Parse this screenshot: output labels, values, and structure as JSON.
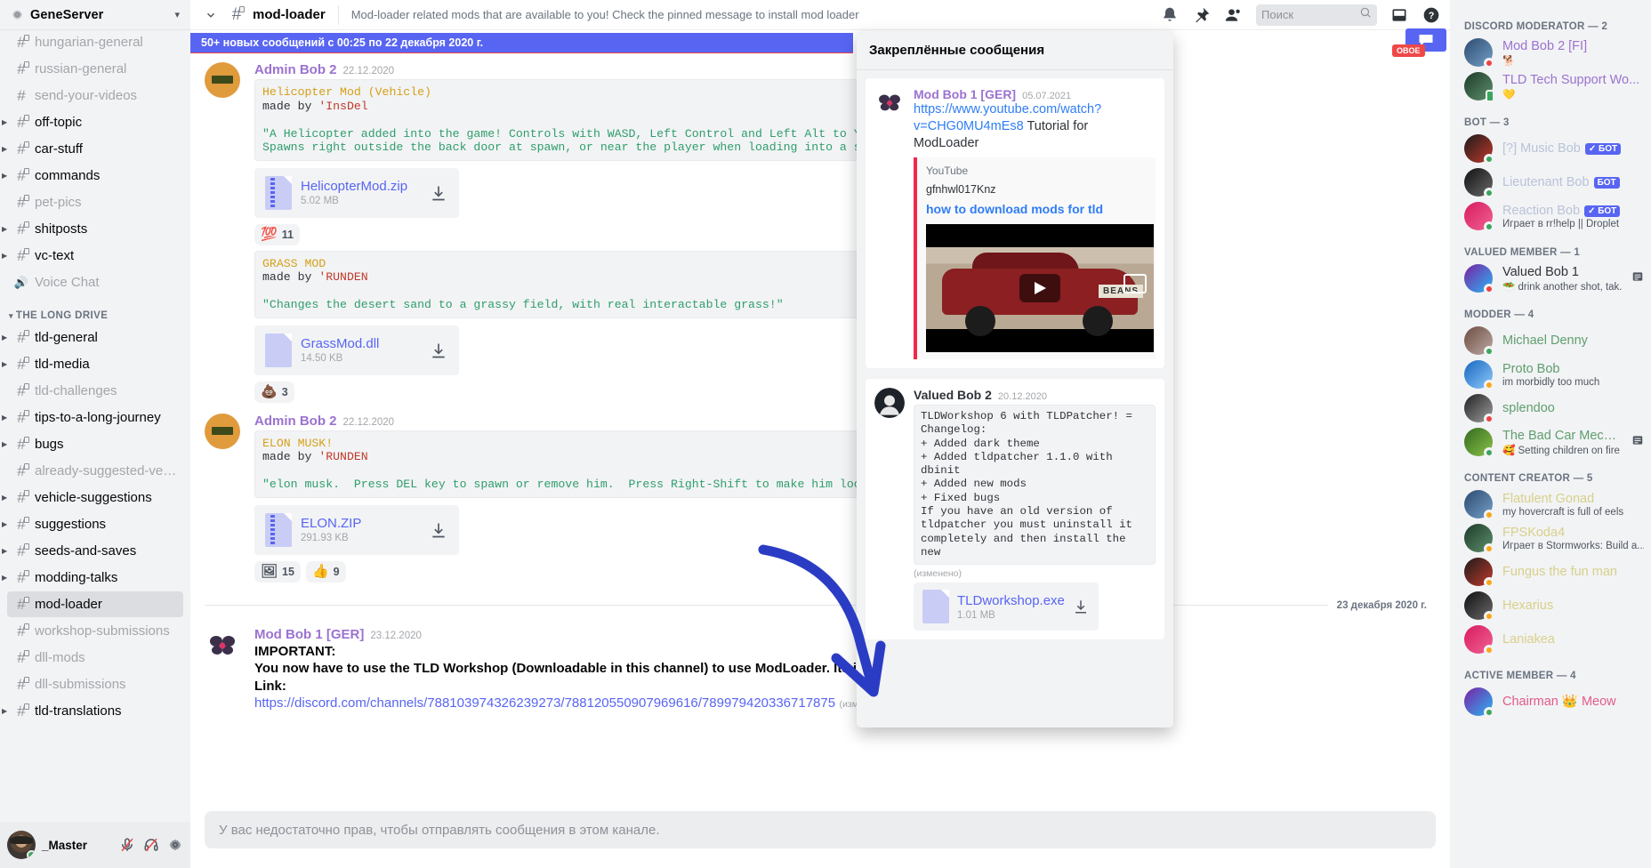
{
  "server": {
    "name": "GeneServer",
    "icon": "gear-icon",
    "chevron": "chevron-down-icon"
  },
  "sidebar": {
    "channels_top": [
      {
        "label": "hungarian-general",
        "state": "muted",
        "arrow": false,
        "locked": true
      },
      {
        "label": "russian-general",
        "state": "muted",
        "arrow": false,
        "locked": true
      },
      {
        "label": "send-your-videos",
        "state": "muted",
        "arrow": false,
        "locked": false
      },
      {
        "label": "off-topic",
        "state": "unread",
        "arrow": true,
        "locked": true
      },
      {
        "label": "car-stuff",
        "state": "unread",
        "arrow": true,
        "locked": true
      },
      {
        "label": "commands",
        "state": "unread",
        "arrow": true,
        "locked": true
      },
      {
        "label": "pet-pics",
        "state": "muted",
        "arrow": false,
        "locked": true
      },
      {
        "label": "shitposts",
        "state": "unread",
        "arrow": true,
        "locked": true
      },
      {
        "label": "vc-text",
        "state": "unread",
        "arrow": true,
        "locked": true
      },
      {
        "label": "Voice Chat",
        "state": "muted",
        "arrow": false,
        "locked": false,
        "voice": true
      }
    ],
    "category": {
      "label": "THE LONG DRIVE",
      "caret": "chevron-down-icon"
    },
    "channels_tld": [
      {
        "label": "tld-general",
        "state": "unread",
        "arrow": true,
        "locked": true
      },
      {
        "label": "tld-media",
        "state": "unread",
        "arrow": true,
        "locked": true
      },
      {
        "label": "tld-challenges",
        "state": "muted",
        "arrow": false,
        "locked": true
      },
      {
        "label": "tips-to-a-long-journey",
        "state": "unread",
        "arrow": true,
        "locked": true
      },
      {
        "label": "bugs",
        "state": "unread",
        "arrow": true,
        "locked": true
      },
      {
        "label": "already-suggested-vehicl...",
        "state": "muted",
        "arrow": false,
        "locked": true
      },
      {
        "label": "vehicle-suggestions",
        "state": "unread",
        "arrow": true,
        "locked": true
      },
      {
        "label": "suggestions",
        "state": "unread",
        "arrow": true,
        "locked": true
      },
      {
        "label": "seeds-and-saves",
        "state": "unread",
        "arrow": true,
        "locked": true
      },
      {
        "label": "modding-talks",
        "state": "unread",
        "arrow": true,
        "locked": true
      },
      {
        "label": "mod-loader",
        "state": "active",
        "arrow": false,
        "locked": true
      },
      {
        "label": "workshop-submissions",
        "state": "muted",
        "arrow": false,
        "locked": true
      },
      {
        "label": "dll-mods",
        "state": "muted",
        "arrow": false,
        "locked": true
      },
      {
        "label": "dll-submissions",
        "state": "muted",
        "arrow": false,
        "locked": true
      },
      {
        "label": "tld-translations",
        "state": "unread",
        "arrow": true,
        "locked": true
      }
    ],
    "user": {
      "name": "_Master",
      "status": "online",
      "icons": [
        "microphone-muted-icon",
        "headphones-muted-icon",
        "gear-icon"
      ]
    }
  },
  "topbar": {
    "collapse_icon": "chevron-down-icon",
    "hash_icon": "hash-locked-icon",
    "channel": "mod-loader",
    "topic": "Mod-loader related mods that are available to you! Check the pinned message to install mod loader",
    "icons": [
      "bell-icon",
      "pin-icon",
      "members-icon",
      "inbox-icon",
      "help-icon"
    ],
    "search_placeholder": "Поиск",
    "search_icon": "search-icon"
  },
  "chat": {
    "new_messages_banner": "50+ новых сообщений с 00:25 по 22 декабря 2020 г.",
    "messages": [
      {
        "author": "Admin Bob 2",
        "timestamp": "22.12.2020",
        "code": {
          "l1": "Helicopter Mod (Vehicle)",
          "l2_pre": "made by ",
          "l2_name": "'InsDel",
          "l3": "\"A Helicopter added into the game! Controls with WASD, Left Control and Left Alt to Yaw, and Space to go u",
          "l4": "Spawns right outside the back door at spawn, or near the player when loading into a save\""
        },
        "file": {
          "name": "HelicopterMod.zip",
          "size": "5.02 MB",
          "type": "zip"
        },
        "reactions": [
          {
            "emoji": "💯",
            "count": "11"
          }
        ]
      },
      {
        "author": "",
        "timestamp": "",
        "code": {
          "l1": "GRASS MOD",
          "l2_pre": "made by ",
          "l2_name": "'RUNDEN",
          "l3": "\"Changes the desert sand to a grassy field, with real interactable grass!\"",
          "l4": ""
        },
        "file": {
          "name": "GrassMod.dll",
          "size": "14.50 KB",
          "type": "doc"
        },
        "reactions": [
          {
            "emoji": "💩",
            "count": "3"
          }
        ]
      },
      {
        "author": "Admin Bob 2",
        "timestamp": "22.12.2020",
        "code": {
          "l1": "ELON MUSK!",
          "l2_pre": "made by ",
          "l2_name": "'RUNDEN",
          "l3": "\"elon musk.  Press DEL key to spawn or remove him.  Press Right-Shift to make him look at you.  Press Alt",
          "l4": ""
        },
        "file": {
          "name": "ELON.ZIP",
          "size": "291.93 KB",
          "type": "zip"
        },
        "reactions": [
          {
            "emoji": "🖼",
            "count": "15"
          },
          {
            "emoji": "👍",
            "count": "9"
          }
        ]
      }
    ],
    "day_divider": "23 декабря 2020 г.",
    "important_message": {
      "author": "Mod Bob 1 [GER]",
      "timestamp": "23.12.2020",
      "title": "IMPORTANT:",
      "body": "You now have to use the TLD Workshop (Downloadable in this channel) to use ModLoader. Its implemented in the Wo",
      "link_label": "Link:",
      "link": "https://discord.com/channels/788103974326239273/788120550907969616/789979420336717875",
      "edited": "(изменено)"
    },
    "composer_placeholder": "У вас недостаточно прав, чтобы отправлять сообщения в этом канале."
  },
  "pinned": {
    "title": "Закреплённые сообщения",
    "cards": [
      {
        "author": "Mod Bob 1 [GER]",
        "timestamp": "05.07.2021",
        "link_line1": "https://www.youtube.com/watch?",
        "link_line2": "v=CHG0MU4mEs8",
        "after_link": " Tutorial for ModLoader",
        "embed": {
          "provider": "YouTube",
          "author": "gfnhwl017Knz",
          "title": "how to download mods for tld",
          "thumb_text": "BEANS"
        }
      },
      {
        "author": "Valued Bob 2",
        "timestamp": "20.12.2020",
        "code": "TLDWorkshop 6 with TLDPatcher! =\nChangelog:\n+ Added dark theme\n+ Added tldpatcher 1.1.0 with\ndbinit\n+ Added new mods\n+ Fixed bugs\nIf you have an old version of\ntldpatcher you must uninstall it\ncompletely and then install the new",
        "edited": "(изменено)",
        "file": {
          "name": "TLDworkshop.exe",
          "size": "1.01 MB"
        }
      }
    ]
  },
  "members": {
    "groups": [
      {
        "title": "DISCORD MODERATOR — 2",
        "people": [
          {
            "name": "Mod Bob 2 [FI]",
            "color": "#9b72d0",
            "sub": "🐕",
            "status": "dnd"
          },
          {
            "name": "TLD Tech Support Wo...",
            "color": "#9b72d0",
            "sub": "💛",
            "status": "mobile"
          }
        ]
      },
      {
        "title": "BOT — 3",
        "people": [
          {
            "name": "[?] Music Bob",
            "color": "#b9c3d8",
            "sub": "",
            "status": "online",
            "bot": "✓ БОТ"
          },
          {
            "name": "Lieutenant Bob",
            "color": "#b9c3d8",
            "sub": "",
            "status": "online",
            "bot": "БОТ"
          },
          {
            "name": "Reaction Bob",
            "color": "#b9c3d8",
            "sub": "Играет в rr!help || Droplet",
            "status": "online",
            "bot": "✓ БОТ"
          }
        ]
      },
      {
        "title": "VALUED MEMBER — 1",
        "people": [
          {
            "name": "Valued Bob 1",
            "color": "#2e3338",
            "sub": "🥗 drink another shot, tak...",
            "status": "dnd",
            "note": true
          }
        ]
      },
      {
        "title": "MODDER — 4",
        "people": [
          {
            "name": "Michael Denny",
            "color": "#5f9e6e",
            "sub": "",
            "status": "online"
          },
          {
            "name": "Proto Bob",
            "color": "#5f9e6e",
            "sub": "im morbidly too much",
            "status": "idle"
          },
          {
            "name": "splendoo",
            "color": "#5f9e6e",
            "sub": "",
            "status": "dnd"
          },
          {
            "name": "The Bad Car Mechanic",
            "color": "#5f9e6e",
            "sub": "🥰 Setting children on fire",
            "status": "online",
            "note": true
          }
        ]
      },
      {
        "title": "CONTENT CREATOR — 5",
        "people": [
          {
            "name": "Flatulent Gonad",
            "color": "#d8d08a",
            "sub": "my hovercraft is full of eels",
            "status": "idle"
          },
          {
            "name": "FPSKoda4",
            "color": "#d8d08a",
            "sub": "Играет в Stormworks: Build a...",
            "status": "idle"
          },
          {
            "name": "Fungus the fun man",
            "color": "#d8d08a",
            "sub": "",
            "status": "idle"
          },
          {
            "name": "Hexarius",
            "color": "#d8d08a",
            "sub": "",
            "status": "idle"
          },
          {
            "name": "Laniakea",
            "color": "#d8d08a",
            "sub": "",
            "status": "idle"
          }
        ]
      },
      {
        "title": "ACTIVE MEMBER — 4",
        "people": [
          {
            "name": "Chairman 👑 Meow",
            "color": "#e05b8a",
            "sub": "",
            "status": "online"
          }
        ]
      }
    ]
  },
  "overlay": {
    "pin_badge": "OBOE"
  },
  "colors": {
    "accent": "#5865f2",
    "danger": "#f04747",
    "link": "#5865f2",
    "annotation": "#2b3cc4"
  }
}
